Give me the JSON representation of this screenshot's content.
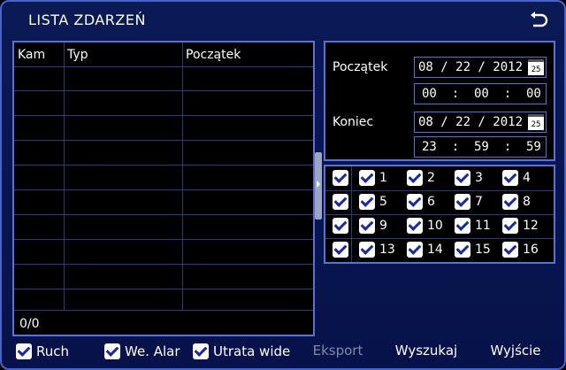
{
  "window": {
    "title": "LISTA ZDARZEŃ",
    "back_icon": "return-arrow-icon"
  },
  "list": {
    "columns": [
      "Kam",
      "Typ",
      "Początek"
    ],
    "rows": [],
    "count": "0/0"
  },
  "date_filter": {
    "start_label": "Początek",
    "start_date": "08 / 22 / 2012",
    "start_time": "00  :  00  :  00",
    "end_label": "Koniec",
    "end_date": "08 / 22 / 2012",
    "end_time": "23  :  59  :  59",
    "calendar_icon_text": "25"
  },
  "cameras": {
    "all_checked": true,
    "channels": [
      "1",
      "2",
      "3",
      "4",
      "5",
      "6",
      "7",
      "8",
      "9",
      "10",
      "11",
      "12",
      "13",
      "14",
      "15",
      "16"
    ]
  },
  "bottom": {
    "checks": [
      {
        "label": "Ruch",
        "checked": true
      },
      {
        "label": "We. Alar",
        "checked": true
      },
      {
        "label": "Utrata wide",
        "checked": true
      }
    ],
    "export_label": "Eksport",
    "search_label": "Wyszukaj",
    "exit_label": "Wyjście"
  },
  "colors": {
    "background": "#07124a",
    "border": "#5a72d6",
    "text": "#ffffff",
    "disabled": "#7f8aa8"
  }
}
